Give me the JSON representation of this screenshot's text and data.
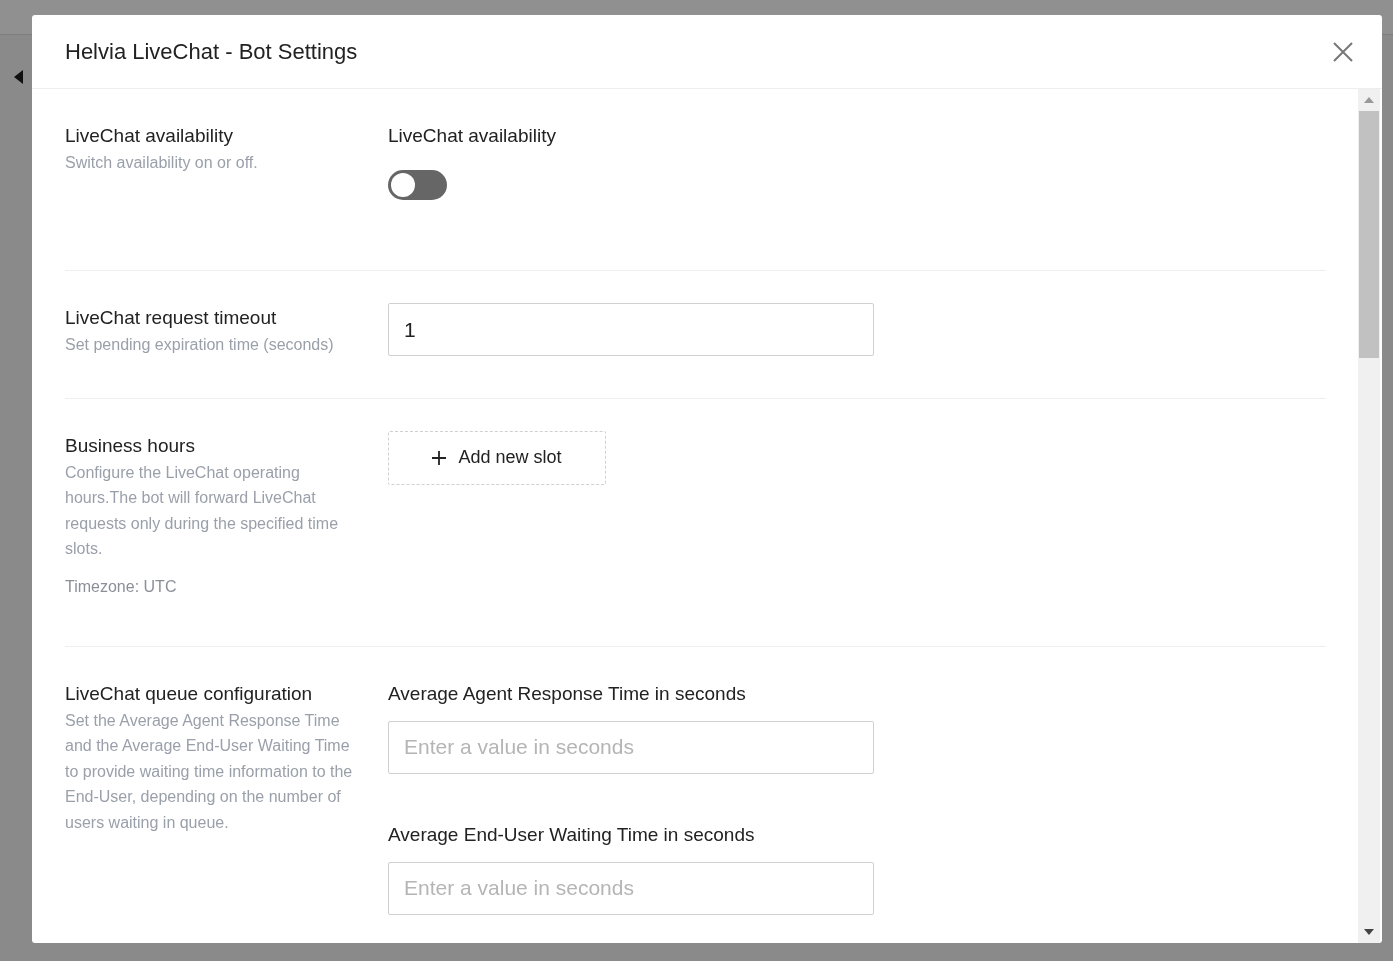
{
  "dialog": {
    "title": "Helvia LiveChat - Bot Settings"
  },
  "sections": [
    {
      "kind": "toggle",
      "label": "LiveChat availability",
      "description": "Switch availability on or off.",
      "field_label": "LiveChat availability",
      "on": false
    },
    {
      "kind": "input",
      "label": "LiveChat request timeout",
      "description": "Set pending expiration time (seconds)",
      "value": "1"
    },
    {
      "kind": "slots",
      "label": "Business hours",
      "description": "Configure the LiveChat operating hours.The bot will forward LiveChat requests only during the specified time slots.",
      "note": "Timezone: UTC",
      "button": "Add new slot"
    },
    {
      "kind": "fields",
      "label": "LiveChat queue configuration",
      "description": "Set the Average Agent Response Time and the Average End-User Waiting Time to provide waiting time information to the End-User, depending on the number of users waiting in queue.",
      "fields": [
        {
          "label": "Average Agent Response Time in seconds",
          "placeholder": "Enter a value in seconds"
        },
        {
          "label": "Average End-User Waiting Time in seconds",
          "placeholder": "Enter a value in seconds"
        }
      ]
    }
  ]
}
